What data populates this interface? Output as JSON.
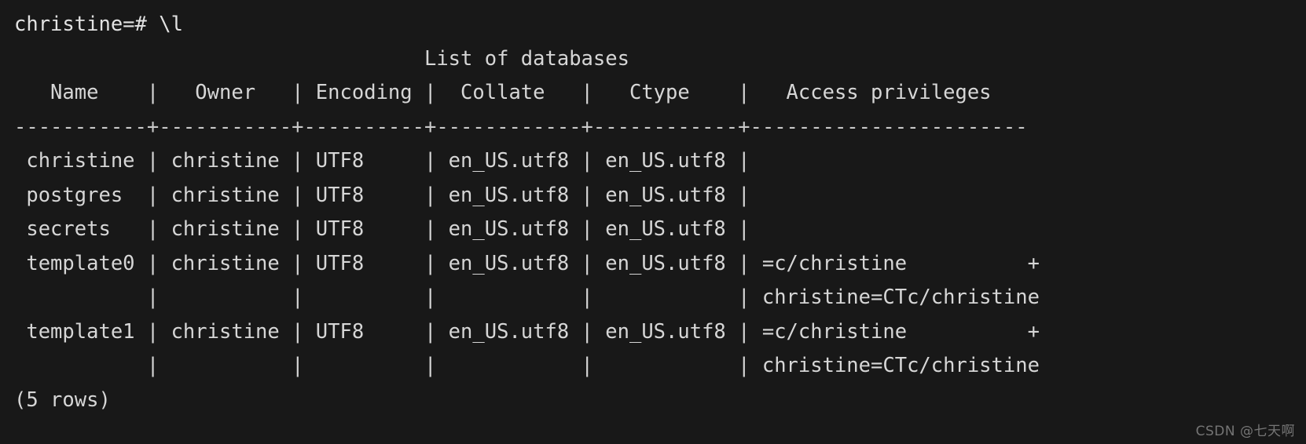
{
  "terminal": {
    "background_color": "#181818",
    "text_color": "#d6d6d6",
    "prompt_line": "christine=# \\l",
    "title_line": "                                  List of databases",
    "header_line": "   Name    |   Owner   | Encoding |  Collate   |   Ctype    |   Access privileges   ",
    "separator_line": "-----------+-----------+----------+------------+------------+-----------------------",
    "footer_line": "(5 rows)",
    "prompt": {
      "user_database": "christine",
      "prompt_symbol": "=#",
      "command": "\\l"
    },
    "table": {
      "title": "List of databases",
      "row_count_label": "(5 rows)",
      "columns": [
        "Name",
        "Owner",
        "Encoding",
        "Collate",
        "Ctype",
        "Access privileges"
      ],
      "rows": [
        {
          "line": " christine | christine | UTF8     | en_US.utf8 | en_US.utf8 | ",
          "name": "christine",
          "owner": "christine",
          "encoding": "UTF8",
          "collate": "en_US.utf8",
          "ctype": "en_US.utf8",
          "access_privileges": "",
          "continuation": null
        },
        {
          "line": " postgres  | christine | UTF8     | en_US.utf8 | en_US.utf8 | ",
          "name": "postgres",
          "owner": "christine",
          "encoding": "UTF8",
          "collate": "en_US.utf8",
          "ctype": "en_US.utf8",
          "access_privileges": "",
          "continuation": null
        },
        {
          "line": " secrets   | christine | UTF8     | en_US.utf8 | en_US.utf8 | ",
          "name": "secrets",
          "owner": "christine",
          "encoding": "UTF8",
          "collate": "en_US.utf8",
          "ctype": "en_US.utf8",
          "access_privileges": "",
          "continuation": null
        },
        {
          "line": " template0 | christine | UTF8     | en_US.utf8 | en_US.utf8 | =c/christine          +",
          "name": "template0",
          "owner": "christine",
          "encoding": "UTF8",
          "collate": "en_US.utf8",
          "ctype": "en_US.utf8",
          "access_privileges": "=c/christine",
          "continuation": "           |           |          |            |            | christine=CTc/christine"
        },
        {
          "line": " template1 | christine | UTF8     | en_US.utf8 | en_US.utf8 | =c/christine          +",
          "name": "template1",
          "owner": "christine",
          "encoding": "UTF8",
          "collate": "en_US.utf8",
          "ctype": "en_US.utf8",
          "access_privileges": "=c/christine",
          "continuation": "           |           |          |            |            | christine=CTc/christine"
        }
      ]
    }
  },
  "watermark": {
    "text": "CSDN @七天啊"
  }
}
